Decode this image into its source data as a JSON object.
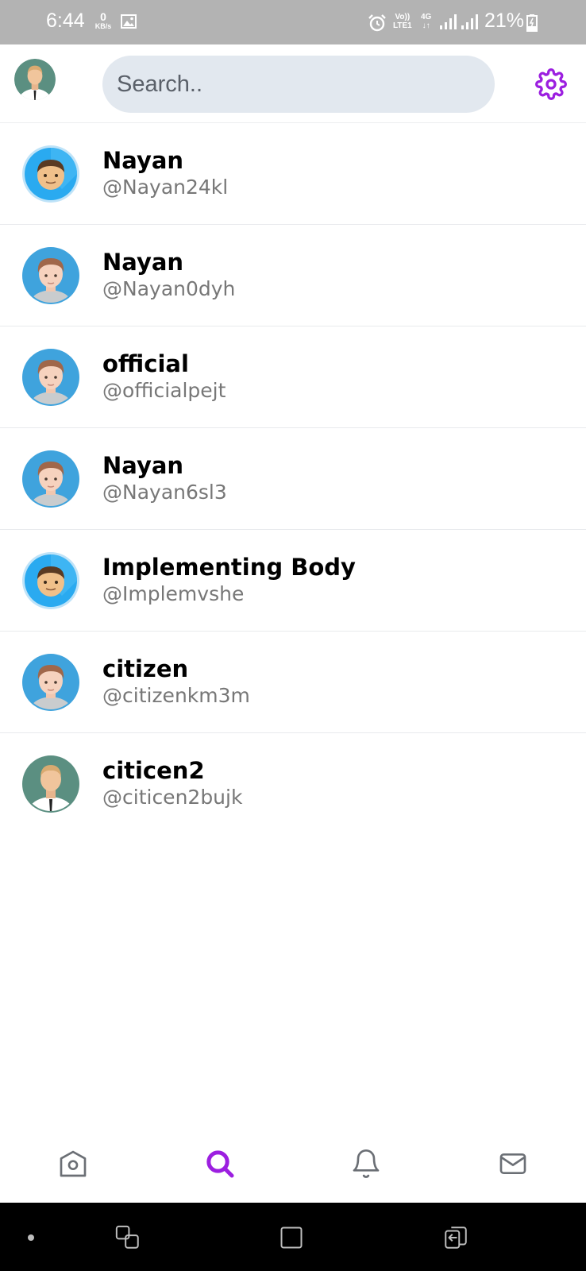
{
  "status_bar": {
    "time": "6:44",
    "speed_value": "0",
    "speed_unit": "KB/s",
    "volte_top": "Vo))",
    "volte_bottom": "LTE1",
    "network": "4G",
    "battery": "21%"
  },
  "header": {
    "search_placeholder": "Search..",
    "settings_icon": "gear-icon",
    "accent_color": "#9c1fe0"
  },
  "results": [
    {
      "name": "Nayan",
      "handle": "@Nayan24kl",
      "avatar": "boy-avatar"
    },
    {
      "name": "Nayan",
      "handle": "@Nayan0dyh",
      "avatar": "man-avatar"
    },
    {
      "name": "official",
      "handle": "@officialpejt",
      "avatar": "man-avatar"
    },
    {
      "name": "Nayan",
      "handle": "@Nayan6sl3",
      "avatar": "man-avatar"
    },
    {
      "name": "Implementing Body",
      "handle": "@Implemvshe",
      "avatar": "boy-avatar"
    },
    {
      "name": "citizen",
      "handle": "@citizenkm3m",
      "avatar": "man-avatar"
    },
    {
      "name": "citicen2",
      "handle": "@citicen2bujk",
      "avatar": "suit-avatar"
    }
  ],
  "bottom_nav": {
    "items": [
      "home-icon",
      "search-icon",
      "bell-icon",
      "mail-icon"
    ],
    "active": "search-icon"
  }
}
